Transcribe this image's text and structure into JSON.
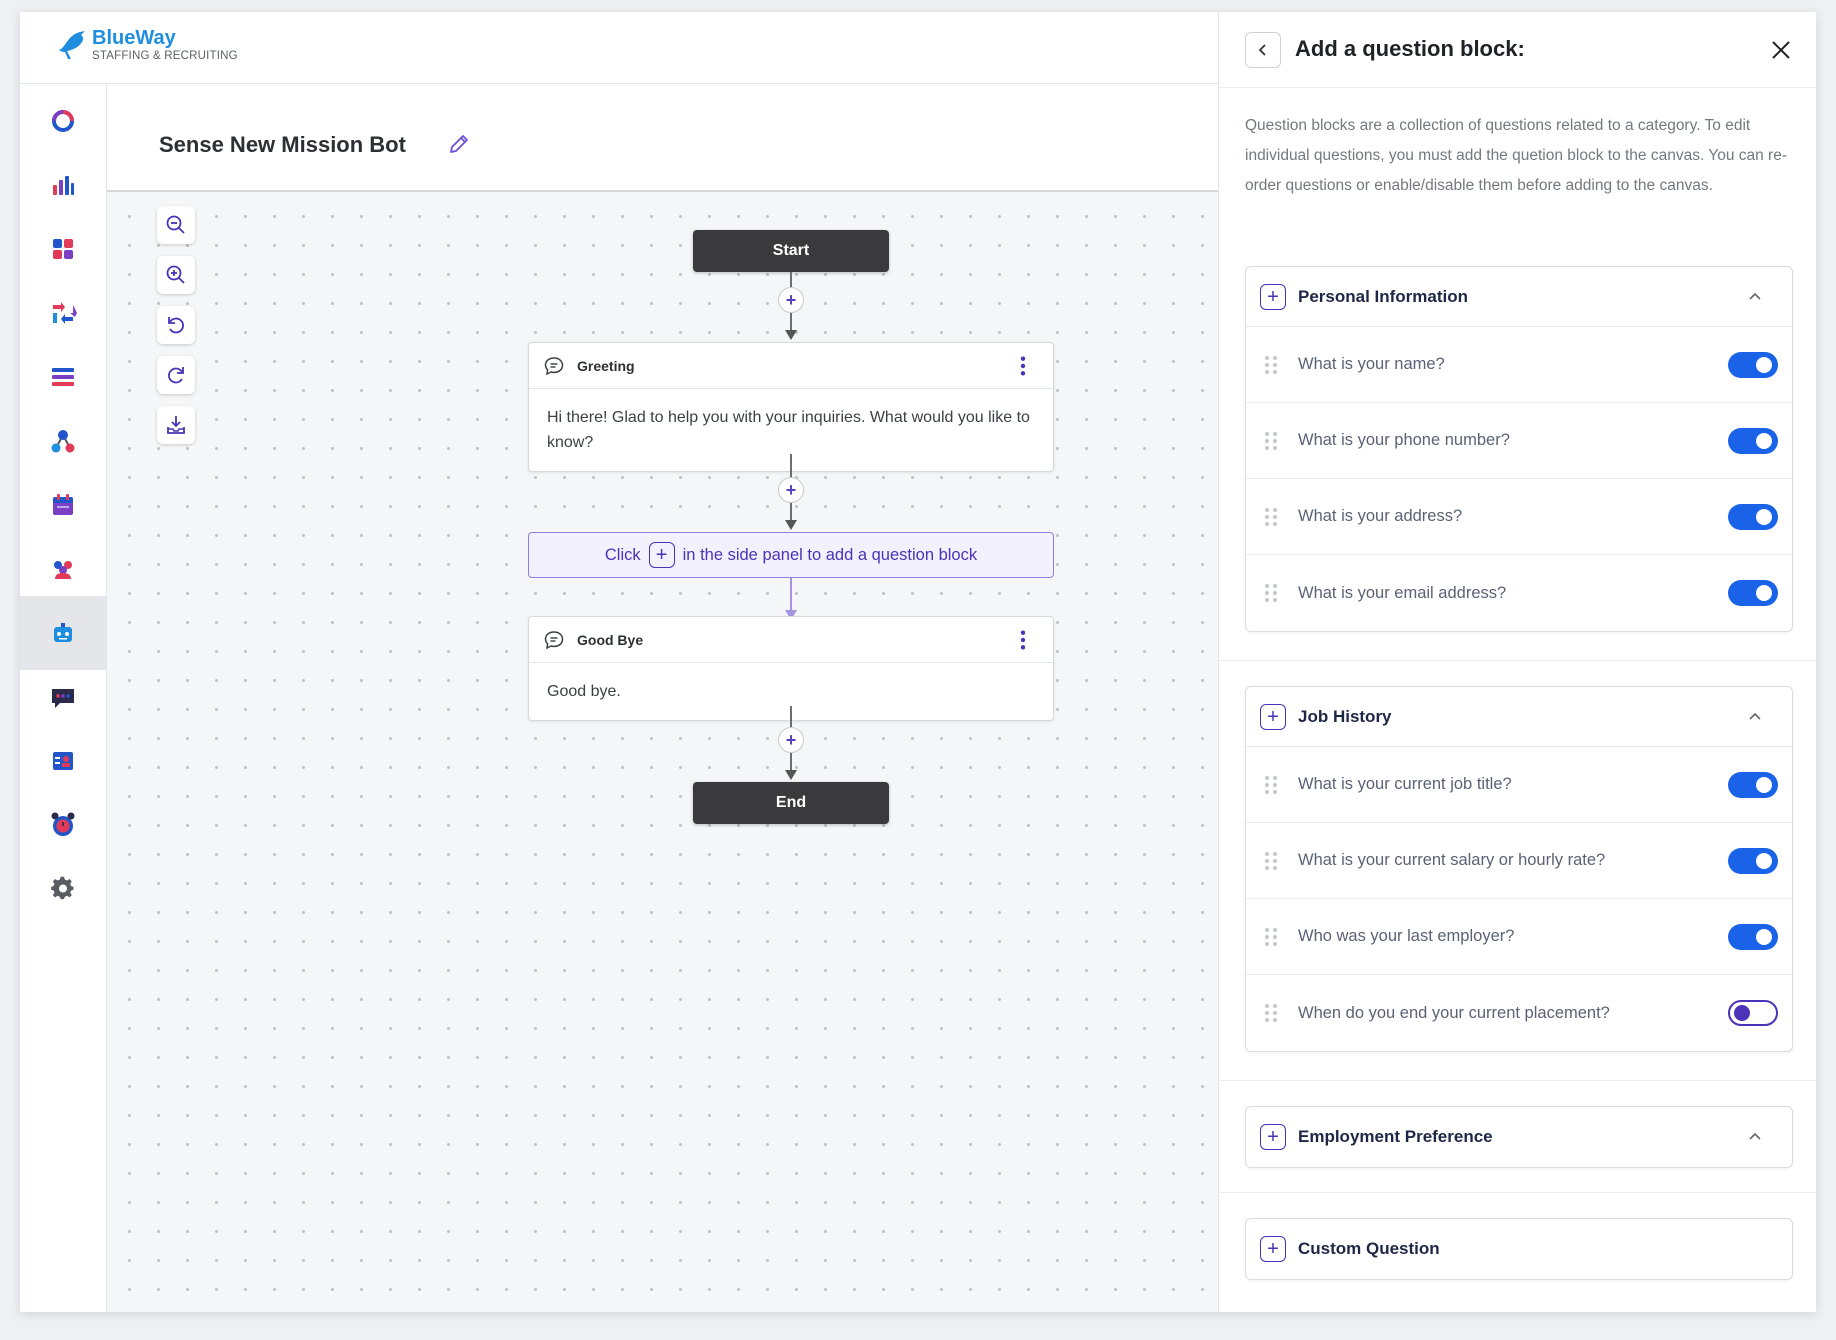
{
  "brand": {
    "name": "BlueWay",
    "tagline": "STAFFING & RECRUITING"
  },
  "sidebar": {
    "items": [
      {
        "name": "nav-item-ring",
        "icon": "ring-icon"
      },
      {
        "name": "nav-item-analytics",
        "icon": "bar-chart-icon"
      },
      {
        "name": "nav-item-dashboard",
        "icon": "grid-icon"
      },
      {
        "name": "nav-item-swap",
        "icon": "arrows-swap-icon"
      },
      {
        "name": "nav-item-list",
        "icon": "list-icon"
      },
      {
        "name": "nav-item-network",
        "icon": "network-icon"
      },
      {
        "name": "nav-item-calendar",
        "icon": "calendar-icon"
      },
      {
        "name": "nav-item-people",
        "icon": "people-icon"
      },
      {
        "name": "nav-item-chatbot",
        "icon": "bot-icon",
        "active": true
      },
      {
        "name": "nav-item-messages",
        "icon": "message-icon"
      },
      {
        "name": "nav-item-contacts",
        "icon": "contact-card-icon"
      },
      {
        "name": "nav-item-alarm",
        "icon": "alarm-clock-icon"
      },
      {
        "name": "nav-item-settings",
        "icon": "gear-icon"
      }
    ]
  },
  "bot": {
    "title": "Sense New Mission Bot"
  },
  "flow": {
    "start_label": "Start",
    "end_label": "End",
    "greeting": {
      "title": "Greeting",
      "body": "Hi there! Glad to help you with your inquiries. What would you like to know?"
    },
    "hint": {
      "before": "Click",
      "after": "in the side panel to add a question block"
    },
    "goodbye": {
      "title": "Good Bye",
      "body": "Good bye."
    },
    "plus_label": "+"
  },
  "panel": {
    "title": "Add a question block:",
    "description": "Question blocks are a collection of questions related to a category. To edit individual questions, you must add the quetion block to the canvas. You can re-order questions or enable/disable them before adding to the canvas.",
    "sections": [
      {
        "title": "Personal Information",
        "questions": [
          {
            "text": "What is your name?",
            "enabled": true
          },
          {
            "text": "What is your phone number?",
            "enabled": true
          },
          {
            "text": "What is your address?",
            "enabled": true
          },
          {
            "text": "What is your email address?",
            "enabled": true
          }
        ]
      },
      {
        "title": "Job History",
        "questions": [
          {
            "text": "What is your current job title?",
            "enabled": true
          },
          {
            "text": "What is your current salary or hourly rate?",
            "enabled": true
          },
          {
            "text": "Who was your last employer?",
            "enabled": true
          },
          {
            "text": "When do you end your current placement?",
            "enabled": false
          }
        ]
      },
      {
        "title": "Employment Preference",
        "questions": []
      },
      {
        "title": "Custom Question",
        "questions": []
      }
    ]
  },
  "colors": {
    "brand_blue": "#1f8ee0",
    "accent_purple": "#4a33b8",
    "toggle_on": "#1a63e8",
    "node_dark": "#3a3a3c"
  }
}
